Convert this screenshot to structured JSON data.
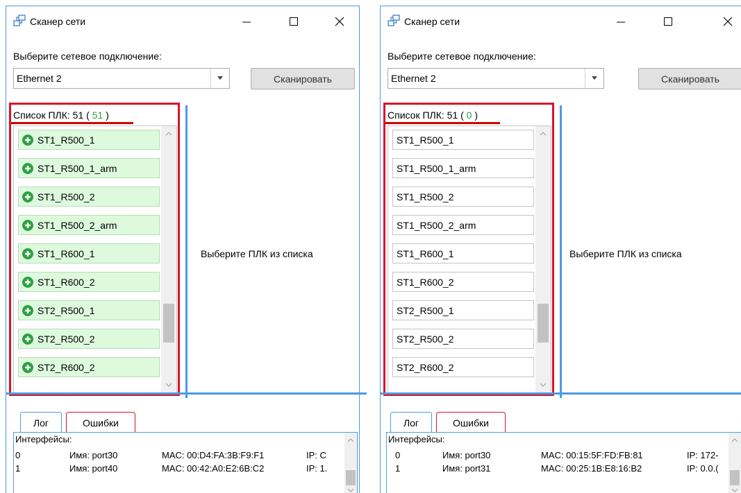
{
  "colors": {
    "accent": "#4a9be3",
    "highlight_red": "#d9142b",
    "online_green": "#2ea043",
    "item_bg_online": "#ddfadd"
  },
  "windows": [
    {
      "title": "Сканер сети",
      "connection_label": "Выберите сетевое подключение:",
      "connection_value": "Ethernet 2",
      "scan_label": "Сканировать",
      "plc_header_prefix": "Список ПЛК: 51 (",
      "plc_online_count": "51",
      "plc_header_suffix": ")",
      "plc_items": [
        "ST1_R500_1",
        "ST1_R500_1_arm",
        "ST1_R500_2",
        "ST1_R500_2_arm",
        "ST1_R600_1",
        "ST1_R600_2",
        "ST2_R500_1",
        "ST2_R500_2",
        "ST2_R600_2"
      ],
      "plc_item_icon": "plus-circle-icon",
      "select_hint": "Выберите ПЛК из списка",
      "tabs": [
        "Лог",
        "Ошибки"
      ],
      "log_header": "Интерфейсы:",
      "log_rows": [
        {
          "index": "0",
          "name": "Имя: port30",
          "mac": "MAC: 00:D4:FA:3B:F9:F1",
          "ip": "IP: C"
        },
        {
          "index": "1",
          "name": "Имя: port40",
          "mac": "MAC: 00:42:A0:E2:6B:C2",
          "ip": "IP: 1."
        }
      ]
    },
    {
      "title": "Сканер сети",
      "connection_label": "Выберите сетевое подключение:",
      "connection_value": "Ethernet 2",
      "scan_label": "Сканировать",
      "plc_header_prefix": "Список ПЛК: 51 (",
      "plc_online_count": "0",
      "plc_header_suffix": ")",
      "plc_items": [
        "ST1_R500_1",
        "ST1_R500_1_arm",
        "ST1_R500_2",
        "ST1_R500_2_arm",
        "ST1_R600_1",
        "ST1_R600_2",
        "ST2_R500_1",
        "ST2_R500_2",
        "ST2_R600_2"
      ],
      "select_hint": "Выберите ПЛК из списка",
      "tabs": [
        "Лог",
        "Ошибки"
      ],
      "log_header": "Интерфейсы:",
      "log_rows": [
        {
          "index": "0",
          "name": "Имя: port30",
          "mac": "MAC: 00:15:5F:FD:FB:81",
          "ip": "IP: 172-"
        },
        {
          "index": "1",
          "name": "Имя: port31",
          "mac": "MAC: 00:25:1B:E8:16:B2",
          "ip": "IP: 0.0.("
        }
      ]
    }
  ]
}
